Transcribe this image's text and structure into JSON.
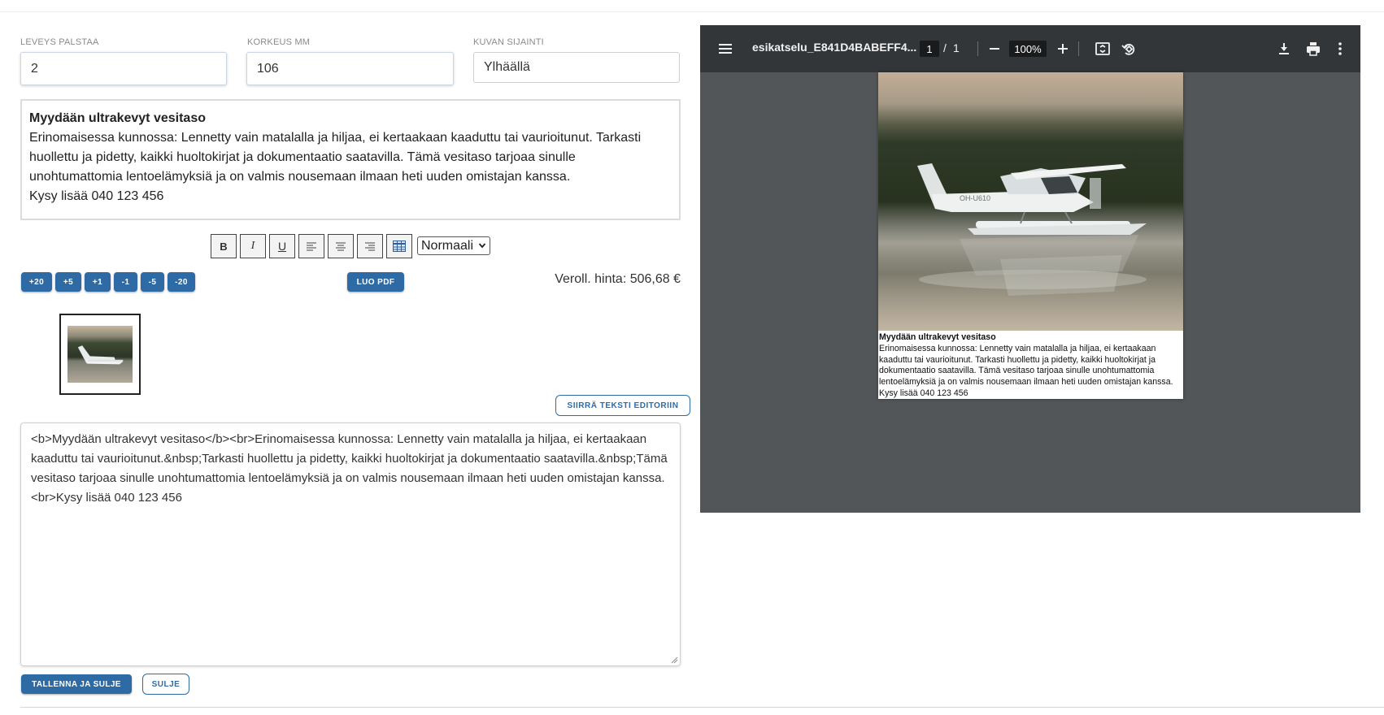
{
  "fields": {
    "width": {
      "label": "LEVEYS PALSTAA",
      "value": "2"
    },
    "height": {
      "label": "KORKEUS MM",
      "value": "106"
    },
    "position": {
      "label": "KUVAN SIJAINTI",
      "value": "Ylhäällä"
    }
  },
  "preview": {
    "title": "Myydään ultrakevyt vesitaso",
    "body": "Erinomaisessa kunnossa: Lennetty vain matalalla ja hiljaa, ei kertaakaan kaaduttu tai vaurioitunut. Tarkasti huollettu ja pidetty, kaikki huoltokirjat ja dokumentaatio saatavilla. Tämä vesitaso tarjoaa sinulle unohtumattomia lentoelämyksiä ja on valmis nousemaan ilmaan heti uuden omistajan kanssa.",
    "contact": "Kysy lisää 040 123 456"
  },
  "toolbar": {
    "bold": "B",
    "italic": "I",
    "underline": "U",
    "style_select": "Normaali"
  },
  "size_buttons": [
    "+20",
    "+5",
    "+1",
    "-1",
    "-5",
    "-20"
  ],
  "actions": {
    "create_pdf": "LUO PDF",
    "move_text": "SIIRRÄ TEKSTI EDITORIIN",
    "save_close": "TALLENNA JA SULJE",
    "close": "SULJE"
  },
  "price": "Veroll. hinta: 506,68 €",
  "source_html": "<b>Myydään ultrakevyt vesitaso</b><br>Erinomaisessa kunnossa: Lennetty vain matalalla ja hiljaa, ei kertaakaan kaaduttu tai vaurioitunut.&nbsp;Tarkasti huollettu ja pidetty, kaikki huoltokirjat ja dokumentaatio saatavilla.&nbsp;Tämä vesitaso tarjoaa sinulle unohtumattomia lentoelämyksiä ja on valmis nousemaan ilmaan heti uuden omistajan kanssa.<br>Kysy lisää 040 123 456",
  "pdf": {
    "filename": "esikatselu_E841D4BABEFF4...",
    "page_current": "1",
    "page_sep": "/",
    "page_total": "1",
    "zoom": "100%",
    "page_title": "Myydään ultrakevyt vesitaso",
    "page_body": "Erinomaisessa kunnossa: Lennetty vain matalalla ja hiljaa, ei kertaakaan kaaduttu tai vaurioitunut. Tarkasti huollettu ja pidetty, kaikki huoltokirjat ja dokumentaatio saatavilla. Tämä vesitaso tarjoaa sinulle unohtumattomia lentoelämyksiä ja on valmis nousemaan ilmaan heti uuden omistajan kanssa.",
    "page_contact": "Kysy lisää 040 123 456",
    "plane_registration": "OH-U610"
  },
  "colors": {
    "primary": "#2e6ba5",
    "pdf_toolbar": "#323639",
    "pdf_background": "#525659"
  },
  "icons": [
    "menu-icon",
    "zoom-out-icon",
    "zoom-in-icon",
    "fit-page-icon",
    "rotate-icon",
    "download-icon",
    "print-icon",
    "more-vert-icon",
    "align-left-icon",
    "align-center-icon",
    "align-right-icon",
    "table-icon"
  ]
}
